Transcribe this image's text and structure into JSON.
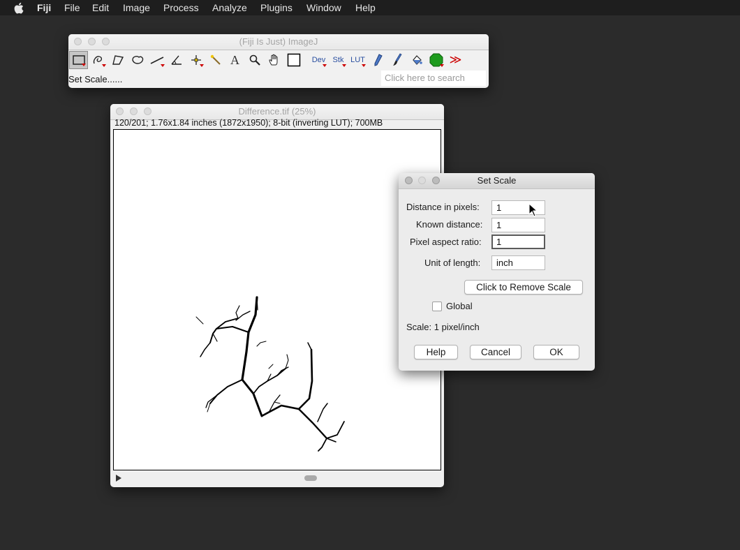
{
  "menubar": {
    "apple_icon": "apple-icon",
    "items": [
      "Fiji",
      "File",
      "Edit",
      "Image",
      "Process",
      "Analyze",
      "Plugins",
      "Window",
      "Help"
    ]
  },
  "imagej_window": {
    "title": "(Fiji Is Just) ImageJ",
    "tools": {
      "rectangle": "rectangle-selection-icon",
      "freehand": "freehand-selection-icon",
      "polygon": "polygon-selection-icon",
      "oval": "oval-selection-icon",
      "line": "line-icon",
      "angle": "angle-icon",
      "point": "point-icon",
      "wand": "wand-icon",
      "text": "A",
      "magnifier": "magnifier-icon",
      "hand": "hand-icon",
      "color_picker": "color-picker-icon",
      "dev": "Dev",
      "stk": "Stk",
      "lut": "LUT",
      "pencil": "pencil-icon",
      "brush": "brush-icon",
      "flood_fill": "flood-fill-icon",
      "green_tool": "green-octagon-icon",
      "more": "≫"
    },
    "status_text": "Set Scale......",
    "search_placeholder": "Click here to search"
  },
  "image_window": {
    "title": "Difference.tif (25%)",
    "info": "120/201; 1.76x1.84 inches (1872x1950); 8-bit (inverting LUT); 700MB"
  },
  "set_scale_dialog": {
    "title": "Set Scale",
    "distance_label": "Distance in pixels:",
    "distance_value": "1",
    "known_label": "Known distance:",
    "known_value": "1",
    "aspect_label": "Pixel aspect ratio:",
    "aspect_value": "1",
    "unit_label": "Unit of length:",
    "unit_value": "inch",
    "remove_scale_label": "Click to Remove Scale",
    "global_label": "Global",
    "global_checked": false,
    "scale_text": "Scale: 1 pixel/inch",
    "help_label": "Help",
    "cancel_label": "Cancel",
    "ok_label": "OK"
  }
}
